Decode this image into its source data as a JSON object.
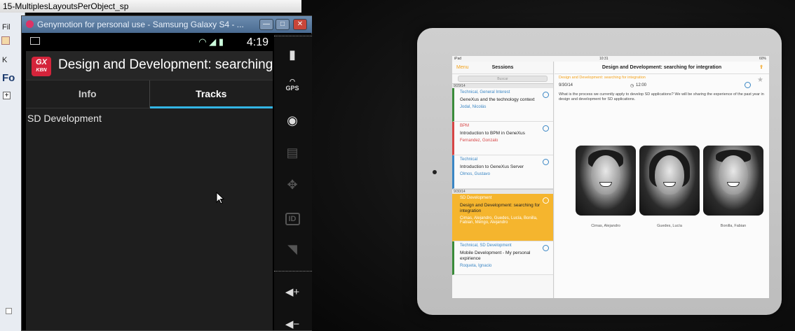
{
  "desktop": {
    "ide_title": "15-MultiplesLayoutsPerObject_sp",
    "menu_fragment": "Fil",
    "label_k": "K",
    "label_fo": "Fo"
  },
  "emulator": {
    "window_title": "Genymotion for personal use - Samsung Galaxy S4 - ...",
    "buttons": {
      "minimize": "—",
      "maximize": "□",
      "close": "✕"
    },
    "status_bar": {
      "time": "4:19"
    },
    "app": {
      "logo_top": "GX",
      "logo_bottom": "KBN",
      "title": "Design and Development: searching..."
    },
    "tabs": [
      {
        "label": "Info",
        "active": false
      },
      {
        "label": "Tracks",
        "active": true
      }
    ],
    "list": [
      "SD Development"
    ],
    "accent_color": "#33b5e5",
    "sidebar": [
      {
        "name": "battery-icon",
        "glyph": "▮"
      },
      {
        "name": "gps-icon",
        "label": "GPS"
      },
      {
        "name": "camera-icon",
        "glyph": "◉"
      },
      {
        "name": "clapper-icon",
        "glyph": "🎬"
      },
      {
        "name": "dpad-icon",
        "glyph": "✥"
      },
      {
        "name": "id-icon",
        "label": "ID"
      },
      {
        "name": "rss-icon",
        "glyph": "◥"
      },
      {
        "name": "volume-up-icon",
        "glyph": "◀+"
      },
      {
        "name": "volume-down-icon",
        "glyph": "◀−"
      }
    ]
  },
  "ipad": {
    "status_left": "iPad",
    "status_center": "10:31",
    "status_right": "60%",
    "left_nav": {
      "back": "Menu",
      "title": "Sessions"
    },
    "search_placeholder": "Buscar",
    "date_1": "9/29/14",
    "date_2": "9/30/14",
    "sessions": [
      {
        "track": "Technical, General Interest",
        "title": "GeneXus and the technology context",
        "speaker": "Jodal, Nicolás",
        "color": "#3a8b3a",
        "selected": false
      },
      {
        "track": "BPM",
        "title": "Introduction to BPM in GeneXus",
        "speaker": "Fernandez, Gonzalo",
        "color": "#d64545",
        "selected": false
      },
      {
        "track": "Technical",
        "title": "Introduction to GeneXus Server",
        "speaker": "Olmos, Gustavo",
        "color": "#3a86c4",
        "selected": false
      },
      {
        "track": "SD Development",
        "title": "Design and Development: searching for integration",
        "speaker": "Cimas, Alejandro, Guedes, Lucía, Bonilla, Fabian, Mengo, Alejandro",
        "color": "#f5b52e",
        "selected": true
      },
      {
        "track": "Technical, SD Development",
        "title": "Mobile Development - My personal expirience",
        "speaker": "Roqueta, Ignacio",
        "color": "#3a8b3a",
        "selected": false
      }
    ],
    "detail": {
      "title": "Design and Development: searching for integration",
      "subtitle": "Design and Development: searching for integration",
      "date": "9/30/14",
      "time": "12:00",
      "description": "What is the process we currently apply to develop SD applications? We will be sharing the experience of the past year in design and development for SD applications.",
      "speakers": [
        "Cimas, Alejandro",
        "Guedes, Lucía",
        "Bonilla, Fabian"
      ]
    }
  }
}
